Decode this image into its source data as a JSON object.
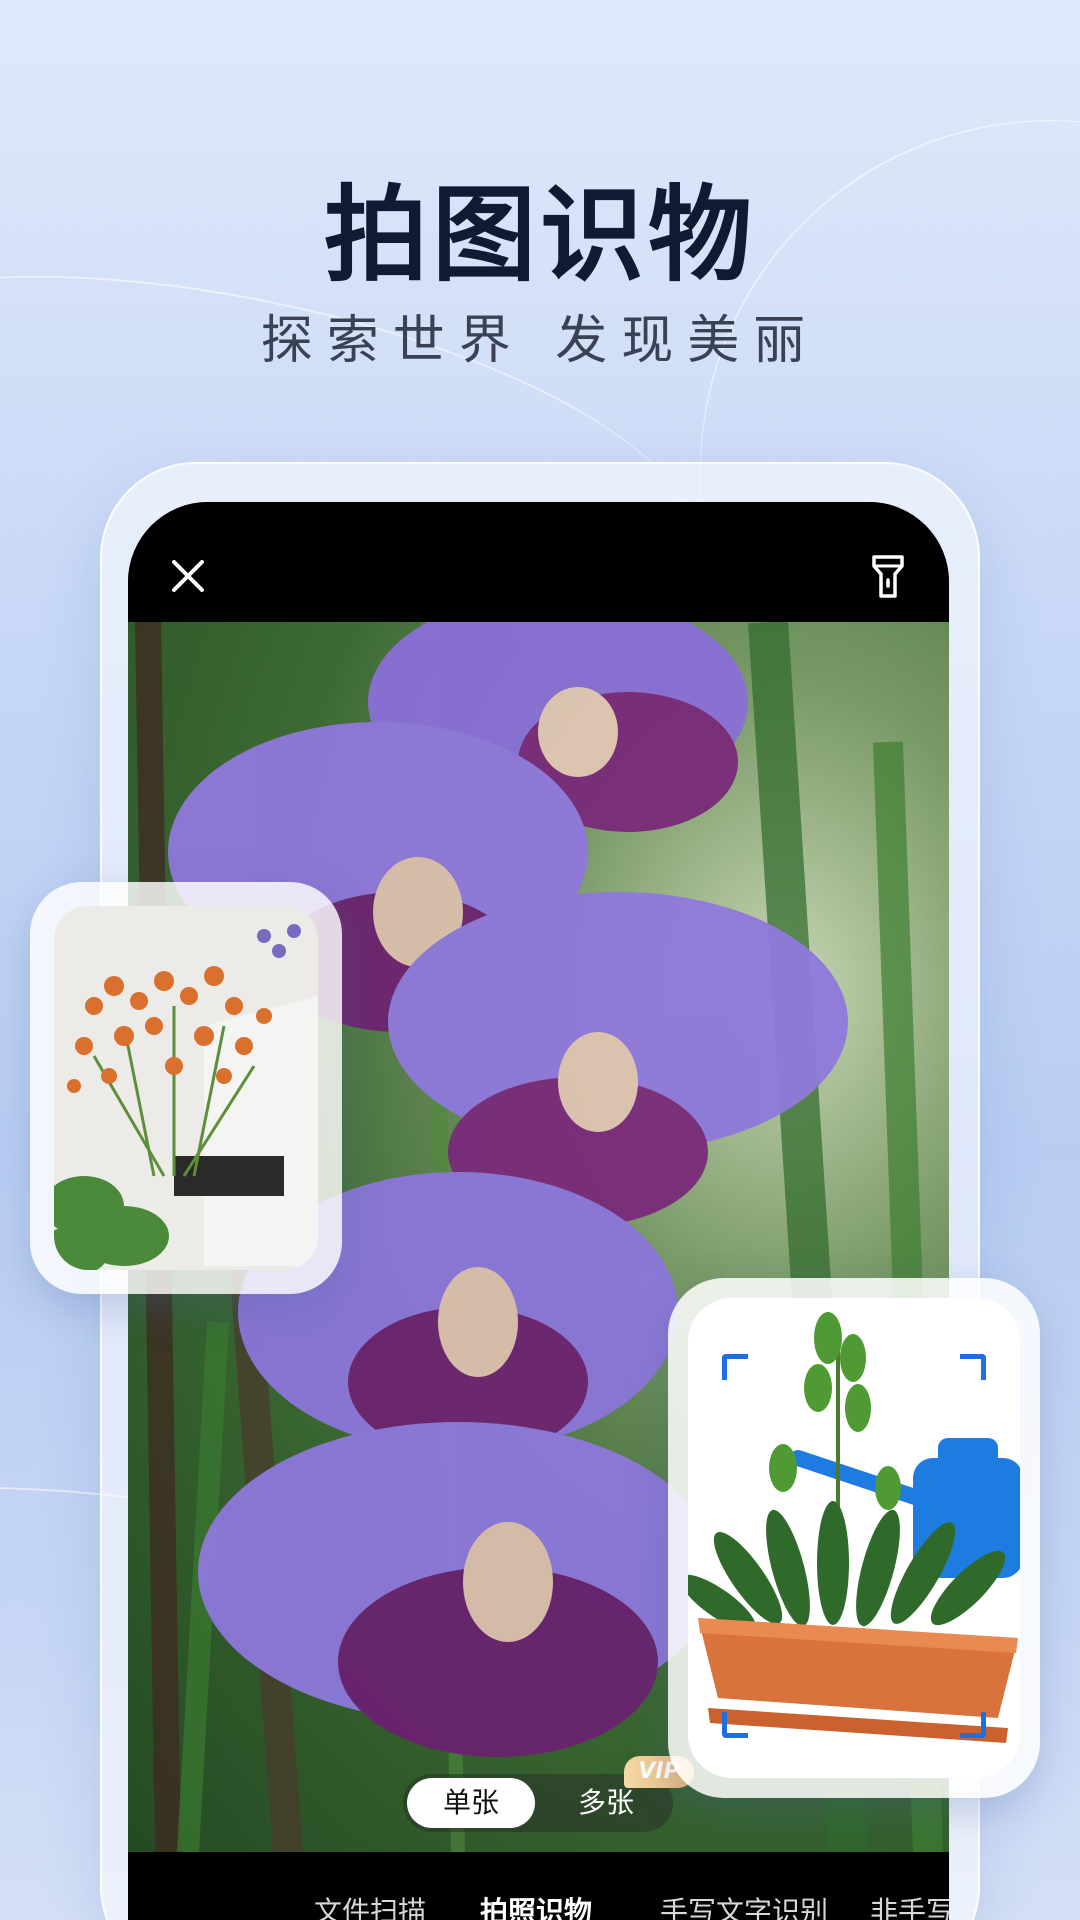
{
  "promo": {
    "title": "拍图识物",
    "subtitle": "探索世界 发现美丽"
  },
  "camera": {
    "top_bar": {
      "close_icon": "close-icon",
      "flash_icon": "flashlight-icon"
    },
    "capture_mode": {
      "single_label": "单张",
      "multi_label": "多张",
      "vip_badge": "VIP",
      "selected": "单张"
    },
    "tabs": [
      {
        "label": "文件扫描",
        "active": false
      },
      {
        "label": "拍照识物",
        "active": true
      },
      {
        "label": "手写文字识别",
        "active": false
      },
      {
        "label": "非手写",
        "active": false
      }
    ]
  },
  "sample_cards": {
    "left": "orange-flowers-photo",
    "right": "potted-plant-photo"
  },
  "colors": {
    "title": "#101a33",
    "accent_blue": "#1f6fe0",
    "vip_gold": "#e9b877"
  }
}
